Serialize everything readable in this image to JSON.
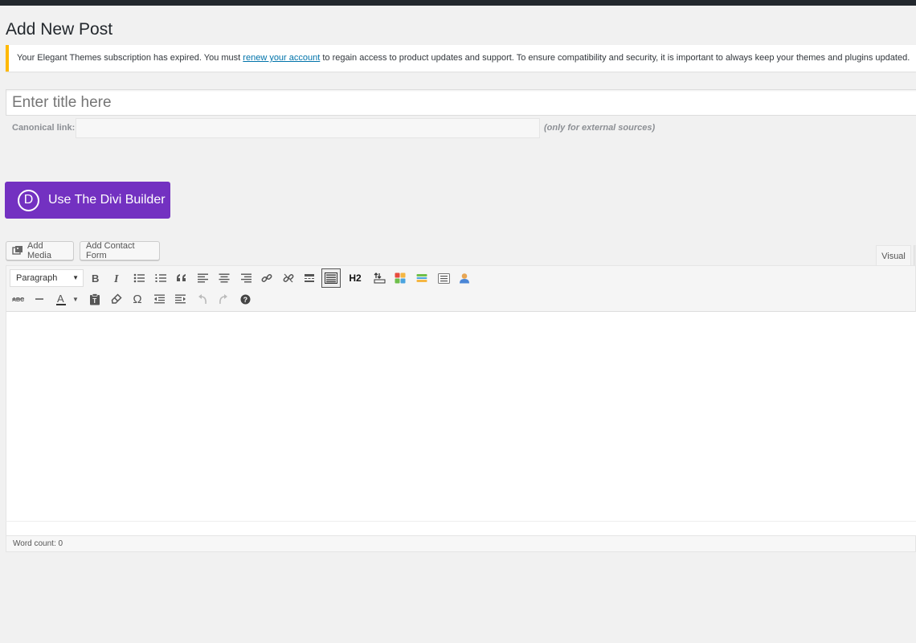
{
  "page": {
    "title": "Add New Post"
  },
  "notice": {
    "text_before": "Your Elegant Themes subscription has expired. You must ",
    "link_text": "renew your account",
    "text_after": " to regain access to product updates and support. To ensure compatibility and security, it is important to always keep your themes and plugins updated."
  },
  "post": {
    "title_placeholder": "Enter title here",
    "canonical_label": "Canonical link:",
    "canonical_note": "(only for external sources)"
  },
  "divi": {
    "logo_letter": "D",
    "label": "Use The Divi Builder"
  },
  "media": {
    "add_media": "Add Media",
    "add_contact_form": "Add Contact Form"
  },
  "editor": {
    "tab_visual": "Visual",
    "format_select": "Paragraph",
    "h2_label": "H2",
    "text_color_letter": "A",
    "omega": "Ω",
    "word_count": "Word count: 0"
  },
  "colors": {
    "accent": "#7331c1",
    "notice_border": "#ffb900",
    "link": "#0073aa",
    "adminbar": "#23282d"
  }
}
